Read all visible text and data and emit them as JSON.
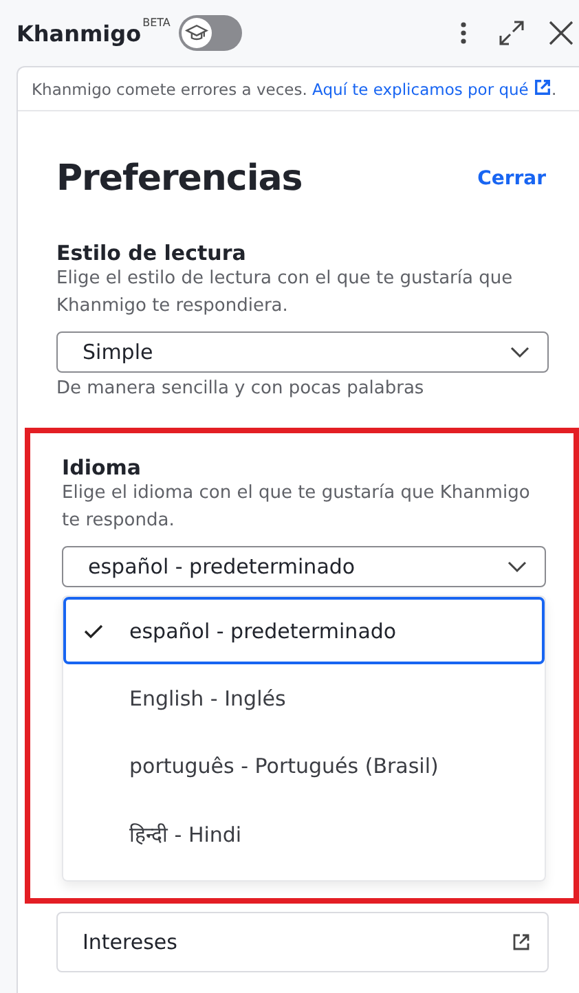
{
  "header": {
    "title": "Khanmigo",
    "badge": "BETA",
    "toggle": {
      "on": false
    }
  },
  "notice": {
    "text": "Khanmigo comete errores a veces.",
    "link": "Aquí te explicamos por qué",
    "end": "."
  },
  "preferences": {
    "title": "Preferencias",
    "close": "Cerrar",
    "reading_style": {
      "label": "Estilo de lectura",
      "description": "Elige el estilo de lectura con el que te gustaría que Khanmigo te respondiera.",
      "value": "Simple",
      "hint": "De manera sencilla y con pocas palabras"
    },
    "language": {
      "highlighted": true,
      "label": "Idioma",
      "description": "Elige el idioma con el que te gustaría que Khanmigo te responda.",
      "value": "español - predeterminado",
      "expanded": true,
      "options": [
        {
          "label": "español - predeterminado",
          "selected": true
        },
        {
          "label": "English - Inglés",
          "selected": false
        },
        {
          "label": "português - Portugués (Brasil)",
          "selected": false
        },
        {
          "label": "हिन्दी - Hindi",
          "selected": false
        }
      ]
    },
    "interests": {
      "label": "Intereses"
    }
  }
}
